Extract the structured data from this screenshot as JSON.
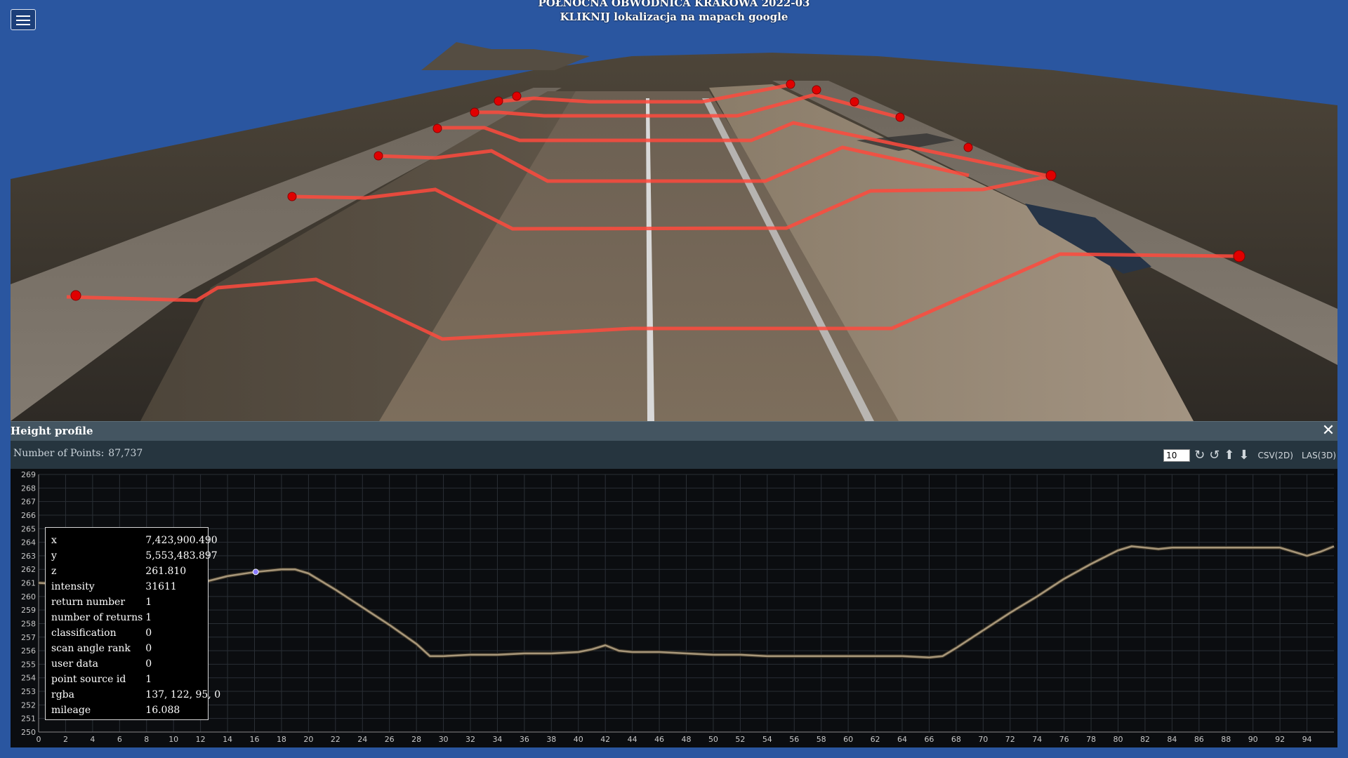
{
  "title": {
    "line1": "PÓŁNOCNA OBWODNICA KRAKOWA 2022-03",
    "line2": "KLIKNIJ lokalizacja na mapach google"
  },
  "menu": {
    "icon": "hamburger-menu-icon"
  },
  "profile": {
    "title": "Height profile",
    "close_icon": "close-icon",
    "points_label": "Number of Points:",
    "points_value": "87,737",
    "width_value": "10",
    "tools": {
      "rotate_cw_icon": "rotate-clockwise-icon",
      "rotate_ccw_icon": "rotate-counterclockwise-icon",
      "move_up_icon": "arrow-up-icon",
      "move_down_icon": "arrow-down-icon",
      "csv_label": "CSV(2D)",
      "las_label": "LAS(3D)"
    },
    "info": [
      {
        "key": "x",
        "value": "7,423,900.490"
      },
      {
        "key": "y",
        "value": "5,553,483.897"
      },
      {
        "key": "z",
        "value": "261.810"
      },
      {
        "key": "intensity",
        "value": "31611"
      },
      {
        "key": "return number",
        "value": "1"
      },
      {
        "key": "number of returns",
        "value": "1"
      },
      {
        "key": "classification",
        "value": "0"
      },
      {
        "key": "scan angle rank",
        "value": "0"
      },
      {
        "key": "user data",
        "value": "0"
      },
      {
        "key": "point source id",
        "value": "1"
      },
      {
        "key": "rgba",
        "value": "137, 122, 95, 0"
      },
      {
        "key": "mileage",
        "value": "16.088"
      }
    ]
  },
  "chart_data": {
    "type": "line",
    "x_ticks": [
      0,
      2,
      4,
      6,
      8,
      10,
      12,
      14,
      16,
      18,
      20,
      22,
      24,
      26,
      28,
      30,
      32,
      34,
      36,
      38,
      40,
      42,
      44,
      46,
      48,
      50,
      52,
      54,
      56,
      58,
      60,
      62,
      64,
      66,
      68,
      70,
      72,
      74,
      76,
      78,
      80,
      82,
      84,
      86,
      88,
      90,
      92,
      94
    ],
    "y_ticks": [
      250,
      251,
      252,
      253,
      254,
      255,
      256,
      257,
      258,
      259,
      260,
      261,
      262,
      263,
      264,
      265,
      266,
      267,
      268,
      269
    ],
    "xlim": [
      0,
      96
    ],
    "ylim": [
      250,
      269
    ],
    "series": [
      {
        "x": [
          0,
          2,
          4,
          6,
          8,
          9,
          10,
          11,
          12,
          14,
          16,
          18,
          19,
          20,
          22,
          24,
          26,
          28,
          29,
          30,
          32,
          34,
          36,
          38,
          40,
          41,
          42,
          43,
          44,
          46,
          48,
          50,
          52,
          54,
          56,
          58,
          60,
          62,
          64,
          66,
          67,
          68,
          70,
          72,
          74,
          76,
          78,
          80,
          81,
          82,
          83,
          84,
          86,
          88,
          90,
          92,
          93,
          94,
          95,
          96
        ],
        "y": [
          261.0,
          260.9,
          260.9,
          260.9,
          260.8,
          260.4,
          260.0,
          260.4,
          261.0,
          261.5,
          261.8,
          262.0,
          262.0,
          261.7,
          260.5,
          259.2,
          257.9,
          256.5,
          255.6,
          255.6,
          255.7,
          255.7,
          255.8,
          255.8,
          255.9,
          256.1,
          256.4,
          256.0,
          255.9,
          255.9,
          255.8,
          255.7,
          255.7,
          255.6,
          255.6,
          255.6,
          255.6,
          255.6,
          255.6,
          255.5,
          255.6,
          256.2,
          257.5,
          258.8,
          260.0,
          261.3,
          262.4,
          263.4,
          263.7,
          263.6,
          263.5,
          263.6,
          263.6,
          263.6,
          263.6,
          263.6,
          263.3,
          263.0,
          263.3,
          263.7
        ]
      }
    ],
    "highlight": {
      "x": 16.088,
      "y": 261.81
    },
    "grid": true
  }
}
